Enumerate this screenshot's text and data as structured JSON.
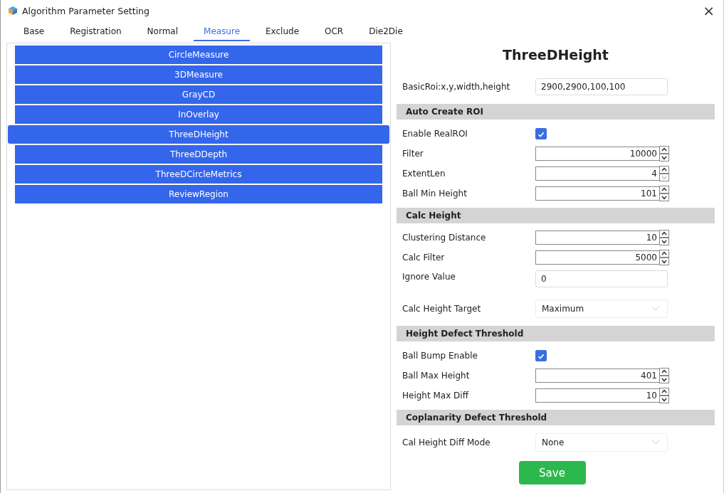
{
  "window": {
    "title": "Algorithm Parameter Setting",
    "close": "×"
  },
  "tabs": [
    {
      "label": "Base",
      "selected": false
    },
    {
      "label": "Registration",
      "selected": false
    },
    {
      "label": "Normal",
      "selected": false
    },
    {
      "label": "Measure",
      "selected": true
    },
    {
      "label": "Exclude",
      "selected": false
    },
    {
      "label": "OCR",
      "selected": false
    },
    {
      "label": "Die2Die",
      "selected": false
    }
  ],
  "algorithms": [
    {
      "label": "CircleMeasure",
      "selected": false
    },
    {
      "label": "3DMeasure",
      "selected": false
    },
    {
      "label": "GrayCD",
      "selected": false
    },
    {
      "label": "InOverlay",
      "selected": false
    },
    {
      "label": "ThreeDHeight",
      "selected": true
    },
    {
      "label": "ThreeDDepth",
      "selected": false
    },
    {
      "label": "ThreeDCircleMetrics",
      "selected": false
    },
    {
      "label": "ReviewRegion",
      "selected": false
    }
  ],
  "panel": {
    "title": "ThreeDHeight",
    "rows": [
      {
        "kind": "text",
        "label": "BasicRoi:x,y,width,height",
        "value": "2900,2900,100,100"
      },
      {
        "kind": "section",
        "label": "Auto Create ROI"
      },
      {
        "kind": "checkbox",
        "label": "Enable RealROI",
        "checked": true
      },
      {
        "kind": "spin",
        "label": "Filter",
        "value": "10000",
        "down_disabled": false
      },
      {
        "kind": "spin",
        "label": "ExtentLen",
        "value": "4",
        "down_disabled": true
      },
      {
        "kind": "spin",
        "label": "Ball Min Height",
        "value": "101",
        "down_disabled": false
      },
      {
        "kind": "section",
        "label": "Calc Height"
      },
      {
        "kind": "spin",
        "label": "Clustering Distance",
        "value": "10",
        "down_disabled": false
      },
      {
        "kind": "spin",
        "label": "Calc Filter",
        "value": "5000",
        "down_disabled": false
      },
      {
        "kind": "text",
        "label": "Ignore Value",
        "value": "0"
      },
      {
        "kind": "select",
        "label": "Calc Height Target",
        "value": "Maximum"
      },
      {
        "kind": "section",
        "label": "Height Defect Threshold"
      },
      {
        "kind": "checkbox",
        "label": "Ball Bump Enable",
        "checked": true
      },
      {
        "kind": "spin",
        "label": "Ball Max Height",
        "value": "401",
        "down_disabled": false
      },
      {
        "kind": "spin",
        "label": "Height Max Diff",
        "value": "10",
        "down_disabled": false
      },
      {
        "kind": "section",
        "label": "Coplanarity Defect Threshold"
      },
      {
        "kind": "select",
        "label": "Cal Height Diff Mode",
        "value": "None"
      }
    ],
    "save": "Save"
  }
}
